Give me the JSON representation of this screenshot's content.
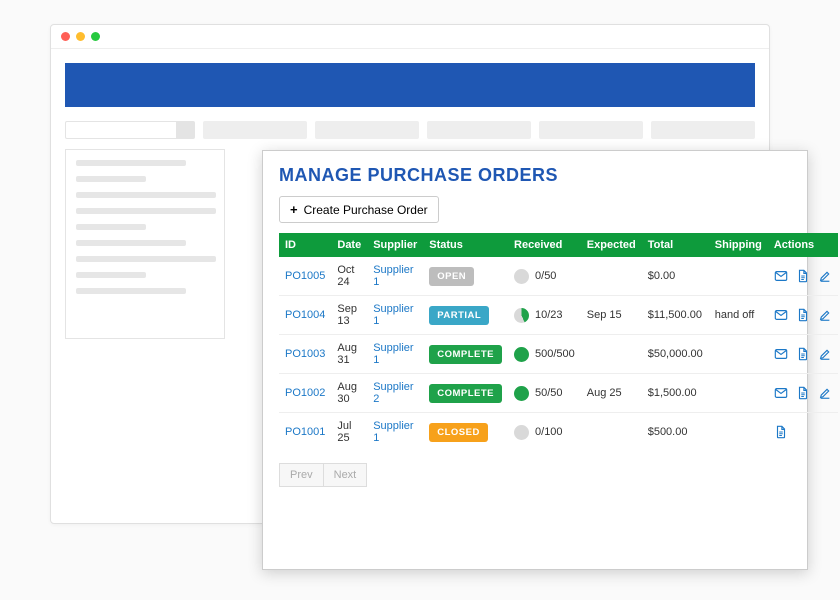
{
  "page": {
    "title": "MANAGE PURCHASE ORDERS",
    "create_label": "Create Purchase Order"
  },
  "table": {
    "headers": {
      "id": "ID",
      "date": "Date",
      "supplier": "Supplier",
      "status": "Status",
      "received": "Received",
      "expected": "Expected",
      "total": "Total",
      "shipping": "Shipping",
      "actions": "Actions"
    },
    "rows": [
      {
        "id": "PO1005",
        "date": "Oct 24",
        "supplier": "Supplier 1",
        "status_label": "OPEN",
        "status_class": "b-open",
        "received_text": "0/50",
        "received_state": "empty",
        "expected": "",
        "total": "$0.00",
        "shipping": "",
        "actions": [
          "mail",
          "doc",
          "edit"
        ]
      },
      {
        "id": "PO1004",
        "date": "Sep 13",
        "supplier": "Supplier 1",
        "status_label": "PARTIAL",
        "status_class": "b-partial",
        "received_text": "10/23",
        "received_state": "partial",
        "expected": "Sep 15",
        "total": "$11,500.00",
        "shipping": "hand off",
        "actions": [
          "mail",
          "doc",
          "edit"
        ]
      },
      {
        "id": "PO1003",
        "date": "Aug 31",
        "supplier": "Supplier 1",
        "status_label": "COMPLETE",
        "status_class": "b-complete",
        "received_text": "500/500",
        "received_state": "full",
        "expected": "",
        "total": "$50,000.00",
        "shipping": "",
        "actions": [
          "mail",
          "doc",
          "edit"
        ]
      },
      {
        "id": "PO1002",
        "date": "Aug 30",
        "supplier": "Supplier 2",
        "status_label": "COMPLETE",
        "status_class": "b-complete",
        "received_text": "50/50",
        "received_state": "full",
        "expected": "Aug 25",
        "total": "$1,500.00",
        "shipping": "",
        "actions": [
          "mail",
          "doc",
          "edit"
        ]
      },
      {
        "id": "PO1001",
        "date": "Jul 25",
        "supplier": "Supplier 1",
        "status_label": "CLOSED",
        "status_class": "b-closed",
        "received_text": "0/100",
        "received_state": "empty",
        "expected": "",
        "total": "$500.00",
        "shipping": "",
        "actions": [
          "doc"
        ]
      }
    ]
  },
  "pager": {
    "prev": "Prev",
    "next": "Next"
  },
  "icons": {
    "mail": "mail-icon",
    "doc": "document-icon",
    "edit": "edit-icon"
  }
}
